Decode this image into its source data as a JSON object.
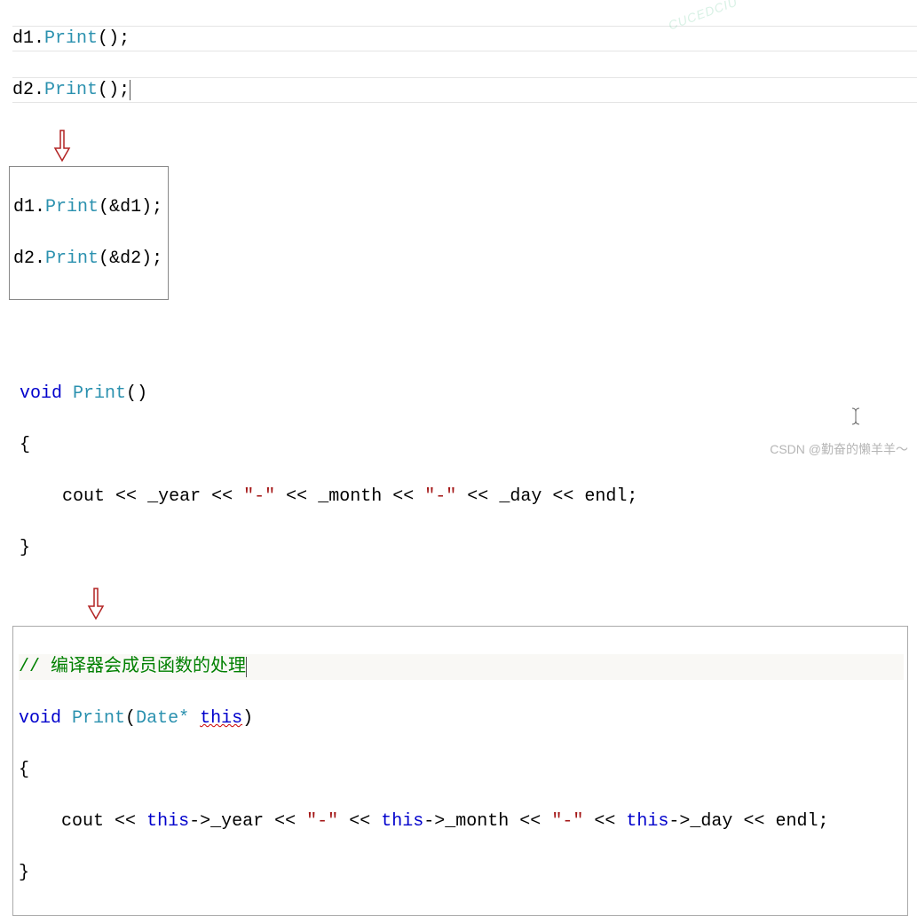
{
  "watermark_top": "CUCEDCIU",
  "watermark_bottom": "CSDN @勤奋的懒羊羊～",
  "tokens": {
    "d1": "d1",
    "d2": "d2",
    "dot": ".",
    "Print": "Print",
    "open_p": "(",
    "close_p": ")",
    "semi": ";",
    "amp_d1": "&d1",
    "amp_d2": "&d2",
    "void": "void",
    "brace_o": "{",
    "brace_c": "}",
    "cout": "cout",
    "ins": "<<",
    "_year": "_year",
    "_month": "_month",
    "_day": "_day",
    "dash_str": "\"-\"",
    "endl": "endl",
    "comment": "// 编译器会成员函数的处理",
    "Date_star": "Date*",
    "this": "this",
    "arrow": "->",
    "indent4": "    "
  }
}
